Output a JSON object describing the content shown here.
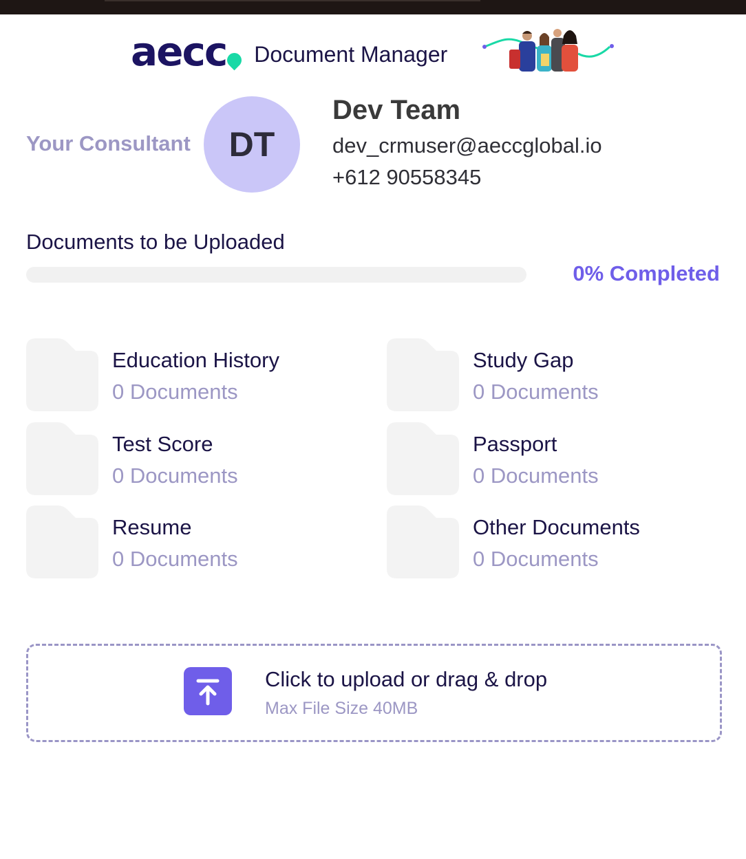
{
  "header": {
    "logo_text": "aecc",
    "app_title": "Document Manager"
  },
  "consultant": {
    "label": "Your Consultant",
    "initials": "DT",
    "name": "Dev Team",
    "email": "dev_crmuser@aeccglobal.io",
    "phone": "+612 90558345"
  },
  "progress": {
    "heading": "Documents to be Uploaded",
    "percent": 0,
    "label": "0% Completed"
  },
  "categories": [
    {
      "name": "Education History",
      "count": "0 Documents"
    },
    {
      "name": "Study Gap",
      "count": "0 Documents"
    },
    {
      "name": "Test Score",
      "count": "0 Documents"
    },
    {
      "name": "Passport",
      "count": "0 Documents"
    },
    {
      "name": "Resume",
      "count": "0 Documents"
    },
    {
      "name": "Other Documents",
      "count": "0 Documents"
    }
  ],
  "upload": {
    "title": "Click to upload or drag & drop",
    "subtitle": "Max File Size 40MB"
  },
  "colors": {
    "accent": "#6f5ee9",
    "brand_navy": "#1c1462",
    "brand_green": "#19d9a6",
    "muted_text": "#9c97c4",
    "avatar_bg": "#cac6f8"
  },
  "icons": {
    "folder": "folder-icon",
    "upload": "upload-arrow-icon"
  }
}
